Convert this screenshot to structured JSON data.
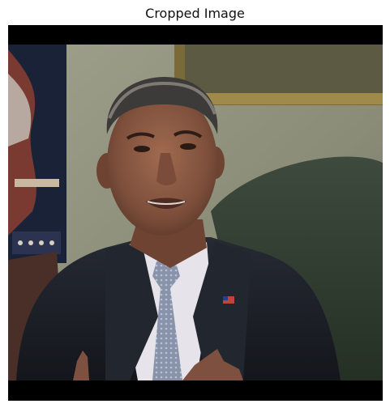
{
  "figure": {
    "title": "Cropped Image"
  },
  "colors": {
    "letterbox": "#000000",
    "wall": "#8b8c78",
    "suit": "#1c1f26",
    "shirt": "#e9e6ee",
    "tie": "#8c97ad",
    "skin": "#8a5a44"
  }
}
